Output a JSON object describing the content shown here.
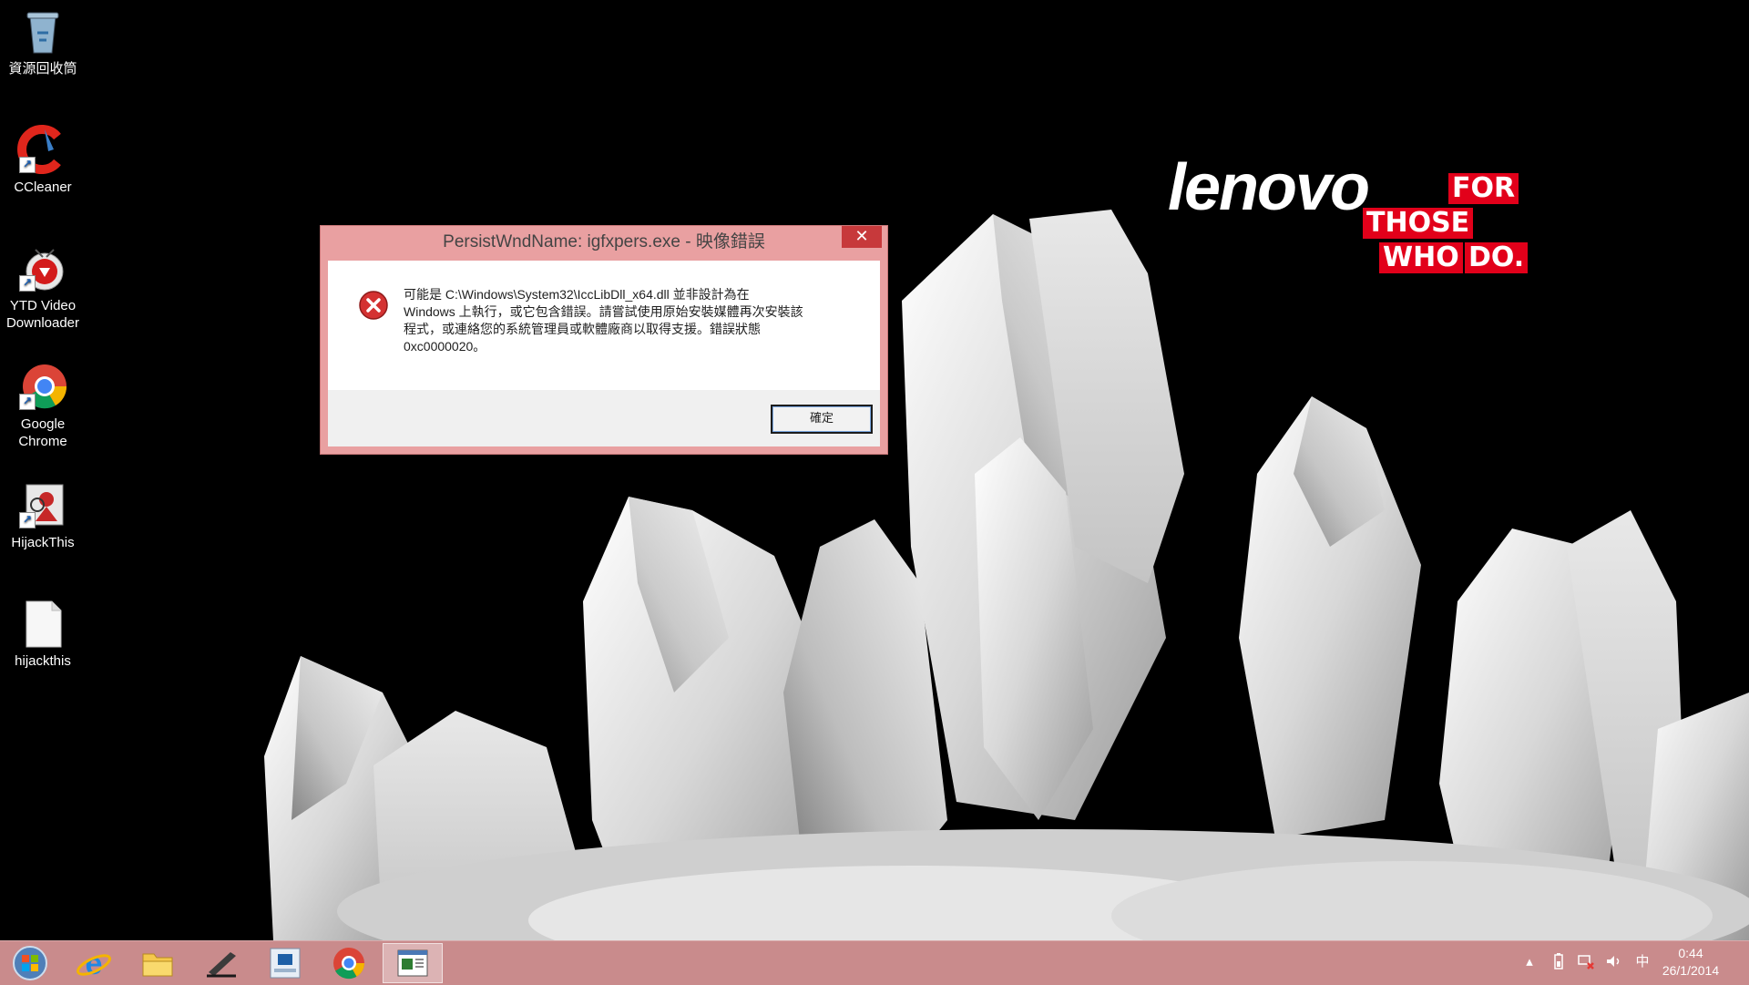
{
  "desktop": {
    "icons": [
      {
        "label": "資源回收筒",
        "icon": "recycle-bin-icon"
      },
      {
        "label": "CCleaner",
        "icon": "ccleaner-icon"
      },
      {
        "label": "YTD Video Downloader",
        "icon": "ytd-video-downloader-icon"
      },
      {
        "label": "Google Chrome",
        "icon": "google-chrome-icon"
      },
      {
        "label": "HijackThis",
        "icon": "hijackthis-icon"
      },
      {
        "label": "hijackthis",
        "icon": "text-file-icon"
      }
    ]
  },
  "wallpaper": {
    "brand": "lenovo",
    "tagline": [
      "FOR",
      "THOSE",
      "WHO",
      "DO."
    ],
    "brand_color": "#e2001a"
  },
  "dialog": {
    "title": "PersistWndName: igfxpers.exe - 映像錯誤",
    "close_label": "✕",
    "message_lines": [
      "可能是 C:\\Windows\\System32\\IccLibDll_x64.dll 並非設計為在",
      "Windows 上執行，或它包含錯誤。請嘗試使用原始安裝媒體再次安裝該",
      "程式，或連絡您的系統管理員或軟體廠商以取得支援。錯誤狀態",
      "0xc0000020。"
    ],
    "ok_label": "確定",
    "icon": "error-icon",
    "frame_color": "#e9a0a1"
  },
  "taskbar": {
    "color": "#c98b8c",
    "pinned": [
      {
        "icon": "start-orb-icon"
      },
      {
        "icon": "internet-explorer-icon"
      },
      {
        "icon": "file-explorer-icon"
      },
      {
        "icon": "app-pen-icon"
      },
      {
        "icon": "intel-app-icon"
      },
      {
        "icon": "google-chrome-icon"
      },
      {
        "icon": "document-window-icon",
        "active": true
      }
    ],
    "tray": {
      "ime_label": "中",
      "time": "0:44",
      "date": "26/1/2014"
    }
  }
}
